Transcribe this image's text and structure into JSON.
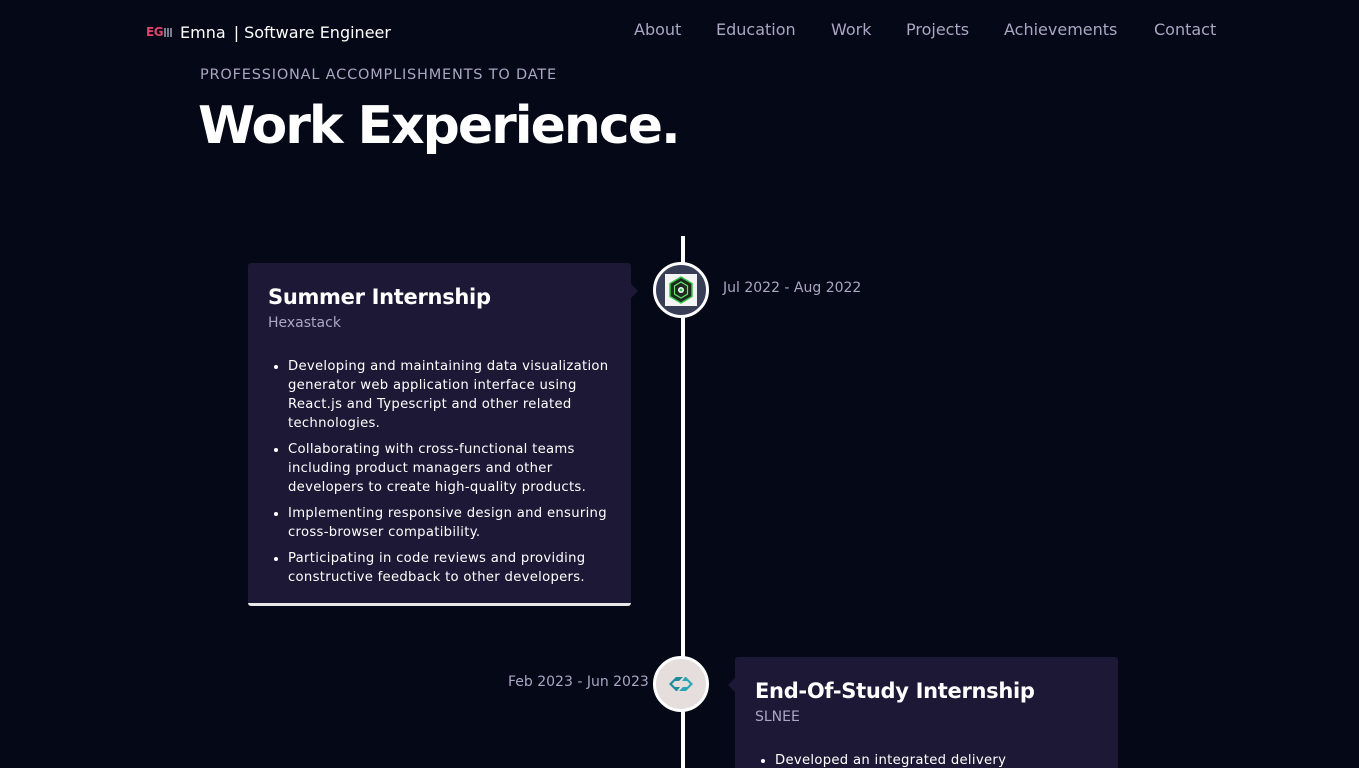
{
  "nav": {
    "logo_text": "EG",
    "name": "Emna",
    "separator": "|",
    "role": "Software Engineer",
    "links": [
      "About",
      "Education",
      "Work",
      "Projects",
      "Achievements",
      "Contact"
    ]
  },
  "header": {
    "eyebrow": "Professional accomplishments to date",
    "title": "Work Experience."
  },
  "experiences": [
    {
      "title": "Summer Internship",
      "company": "Hexastack",
      "date": "Jul 2022 - Aug 2022",
      "icon": "hexastack-logo-icon",
      "icon_bg": "#383e56",
      "points": [
        "Developing and maintaining data visualization generator web application interface using React.js and Typescript and other related technologies.",
        "Collaborating with cross-functional teams including product managers and other developers to create high-quality products.",
        "Implementing responsive design and ensuring cross-browser compatibility.",
        "Participating in code reviews and providing constructive feedback to other developers."
      ]
    },
    {
      "title": "End-Of-Study Internship",
      "company": "SLNEE",
      "date": "Feb 2023 - Jun 2023",
      "icon": "slnee-logo-icon",
      "icon_bg": "#e6dedd",
      "points": [
        "Developed an integrated delivery"
      ]
    }
  ],
  "colors": {
    "background": "#050816",
    "card": "#1d1836",
    "secondary_text": "#aaa6c3",
    "accent": "#e1446d"
  }
}
